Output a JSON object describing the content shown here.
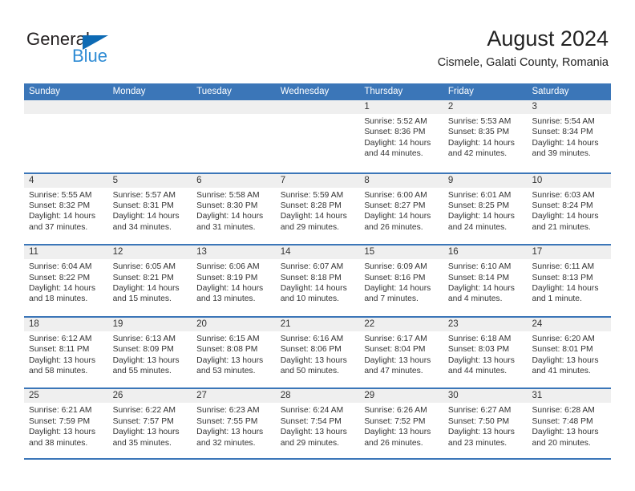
{
  "brand": {
    "name_part1": "General",
    "name_part2": "Blue",
    "triangle_color": "#0d6ab4",
    "blue_text_color": "#2e8bd4"
  },
  "header": {
    "month_title": "August 2024",
    "location": "Cismele, Galati County, Romania"
  },
  "theme": {
    "header_blue": "#3b76b8",
    "daynum_band_gray": "#efefef",
    "text_color": "#333333"
  },
  "calendar": {
    "weekdays": [
      "Sunday",
      "Monday",
      "Tuesday",
      "Wednesday",
      "Thursday",
      "Friday",
      "Saturday"
    ],
    "weeks": [
      [
        {
          "day": "",
          "sunrise": "",
          "sunset": "",
          "daylight_line1": "",
          "daylight_line2": ""
        },
        {
          "day": "",
          "sunrise": "",
          "sunset": "",
          "daylight_line1": "",
          "daylight_line2": ""
        },
        {
          "day": "",
          "sunrise": "",
          "sunset": "",
          "daylight_line1": "",
          "daylight_line2": ""
        },
        {
          "day": "",
          "sunrise": "",
          "sunset": "",
          "daylight_line1": "",
          "daylight_line2": ""
        },
        {
          "day": "1",
          "sunrise": "Sunrise: 5:52 AM",
          "sunset": "Sunset: 8:36 PM",
          "daylight_line1": "Daylight: 14 hours",
          "daylight_line2": "and 44 minutes."
        },
        {
          "day": "2",
          "sunrise": "Sunrise: 5:53 AM",
          "sunset": "Sunset: 8:35 PM",
          "daylight_line1": "Daylight: 14 hours",
          "daylight_line2": "and 42 minutes."
        },
        {
          "day": "3",
          "sunrise": "Sunrise: 5:54 AM",
          "sunset": "Sunset: 8:34 PM",
          "daylight_line1": "Daylight: 14 hours",
          "daylight_line2": "and 39 minutes."
        }
      ],
      [
        {
          "day": "4",
          "sunrise": "Sunrise: 5:55 AM",
          "sunset": "Sunset: 8:32 PM",
          "daylight_line1": "Daylight: 14 hours",
          "daylight_line2": "and 37 minutes."
        },
        {
          "day": "5",
          "sunrise": "Sunrise: 5:57 AM",
          "sunset": "Sunset: 8:31 PM",
          "daylight_line1": "Daylight: 14 hours",
          "daylight_line2": "and 34 minutes."
        },
        {
          "day": "6",
          "sunrise": "Sunrise: 5:58 AM",
          "sunset": "Sunset: 8:30 PM",
          "daylight_line1": "Daylight: 14 hours",
          "daylight_line2": "and 31 minutes."
        },
        {
          "day": "7",
          "sunrise": "Sunrise: 5:59 AM",
          "sunset": "Sunset: 8:28 PM",
          "daylight_line1": "Daylight: 14 hours",
          "daylight_line2": "and 29 minutes."
        },
        {
          "day": "8",
          "sunrise": "Sunrise: 6:00 AM",
          "sunset": "Sunset: 8:27 PM",
          "daylight_line1": "Daylight: 14 hours",
          "daylight_line2": "and 26 minutes."
        },
        {
          "day": "9",
          "sunrise": "Sunrise: 6:01 AM",
          "sunset": "Sunset: 8:25 PM",
          "daylight_line1": "Daylight: 14 hours",
          "daylight_line2": "and 24 minutes."
        },
        {
          "day": "10",
          "sunrise": "Sunrise: 6:03 AM",
          "sunset": "Sunset: 8:24 PM",
          "daylight_line1": "Daylight: 14 hours",
          "daylight_line2": "and 21 minutes."
        }
      ],
      [
        {
          "day": "11",
          "sunrise": "Sunrise: 6:04 AM",
          "sunset": "Sunset: 8:22 PM",
          "daylight_line1": "Daylight: 14 hours",
          "daylight_line2": "and 18 minutes."
        },
        {
          "day": "12",
          "sunrise": "Sunrise: 6:05 AM",
          "sunset": "Sunset: 8:21 PM",
          "daylight_line1": "Daylight: 14 hours",
          "daylight_line2": "and 15 minutes."
        },
        {
          "day": "13",
          "sunrise": "Sunrise: 6:06 AM",
          "sunset": "Sunset: 8:19 PM",
          "daylight_line1": "Daylight: 14 hours",
          "daylight_line2": "and 13 minutes."
        },
        {
          "day": "14",
          "sunrise": "Sunrise: 6:07 AM",
          "sunset": "Sunset: 8:18 PM",
          "daylight_line1": "Daylight: 14 hours",
          "daylight_line2": "and 10 minutes."
        },
        {
          "day": "15",
          "sunrise": "Sunrise: 6:09 AM",
          "sunset": "Sunset: 8:16 PM",
          "daylight_line1": "Daylight: 14 hours",
          "daylight_line2": "and 7 minutes."
        },
        {
          "day": "16",
          "sunrise": "Sunrise: 6:10 AM",
          "sunset": "Sunset: 8:14 PM",
          "daylight_line1": "Daylight: 14 hours",
          "daylight_line2": "and 4 minutes."
        },
        {
          "day": "17",
          "sunrise": "Sunrise: 6:11 AM",
          "sunset": "Sunset: 8:13 PM",
          "daylight_line1": "Daylight: 14 hours",
          "daylight_line2": "and 1 minute."
        }
      ],
      [
        {
          "day": "18",
          "sunrise": "Sunrise: 6:12 AM",
          "sunset": "Sunset: 8:11 PM",
          "daylight_line1": "Daylight: 13 hours",
          "daylight_line2": "and 58 minutes."
        },
        {
          "day": "19",
          "sunrise": "Sunrise: 6:13 AM",
          "sunset": "Sunset: 8:09 PM",
          "daylight_line1": "Daylight: 13 hours",
          "daylight_line2": "and 55 minutes."
        },
        {
          "day": "20",
          "sunrise": "Sunrise: 6:15 AM",
          "sunset": "Sunset: 8:08 PM",
          "daylight_line1": "Daylight: 13 hours",
          "daylight_line2": "and 53 minutes."
        },
        {
          "day": "21",
          "sunrise": "Sunrise: 6:16 AM",
          "sunset": "Sunset: 8:06 PM",
          "daylight_line1": "Daylight: 13 hours",
          "daylight_line2": "and 50 minutes."
        },
        {
          "day": "22",
          "sunrise": "Sunrise: 6:17 AM",
          "sunset": "Sunset: 8:04 PM",
          "daylight_line1": "Daylight: 13 hours",
          "daylight_line2": "and 47 minutes."
        },
        {
          "day": "23",
          "sunrise": "Sunrise: 6:18 AM",
          "sunset": "Sunset: 8:03 PM",
          "daylight_line1": "Daylight: 13 hours",
          "daylight_line2": "and 44 minutes."
        },
        {
          "day": "24",
          "sunrise": "Sunrise: 6:20 AM",
          "sunset": "Sunset: 8:01 PM",
          "daylight_line1": "Daylight: 13 hours",
          "daylight_line2": "and 41 minutes."
        }
      ],
      [
        {
          "day": "25",
          "sunrise": "Sunrise: 6:21 AM",
          "sunset": "Sunset: 7:59 PM",
          "daylight_line1": "Daylight: 13 hours",
          "daylight_line2": "and 38 minutes."
        },
        {
          "day": "26",
          "sunrise": "Sunrise: 6:22 AM",
          "sunset": "Sunset: 7:57 PM",
          "daylight_line1": "Daylight: 13 hours",
          "daylight_line2": "and 35 minutes."
        },
        {
          "day": "27",
          "sunrise": "Sunrise: 6:23 AM",
          "sunset": "Sunset: 7:55 PM",
          "daylight_line1": "Daylight: 13 hours",
          "daylight_line2": "and 32 minutes."
        },
        {
          "day": "28",
          "sunrise": "Sunrise: 6:24 AM",
          "sunset": "Sunset: 7:54 PM",
          "daylight_line1": "Daylight: 13 hours",
          "daylight_line2": "and 29 minutes."
        },
        {
          "day": "29",
          "sunrise": "Sunrise: 6:26 AM",
          "sunset": "Sunset: 7:52 PM",
          "daylight_line1": "Daylight: 13 hours",
          "daylight_line2": "and 26 minutes."
        },
        {
          "day": "30",
          "sunrise": "Sunrise: 6:27 AM",
          "sunset": "Sunset: 7:50 PM",
          "daylight_line1": "Daylight: 13 hours",
          "daylight_line2": "and 23 minutes."
        },
        {
          "day": "31",
          "sunrise": "Sunrise: 6:28 AM",
          "sunset": "Sunset: 7:48 PM",
          "daylight_line1": "Daylight: 13 hours",
          "daylight_line2": "and 20 minutes."
        }
      ]
    ]
  }
}
